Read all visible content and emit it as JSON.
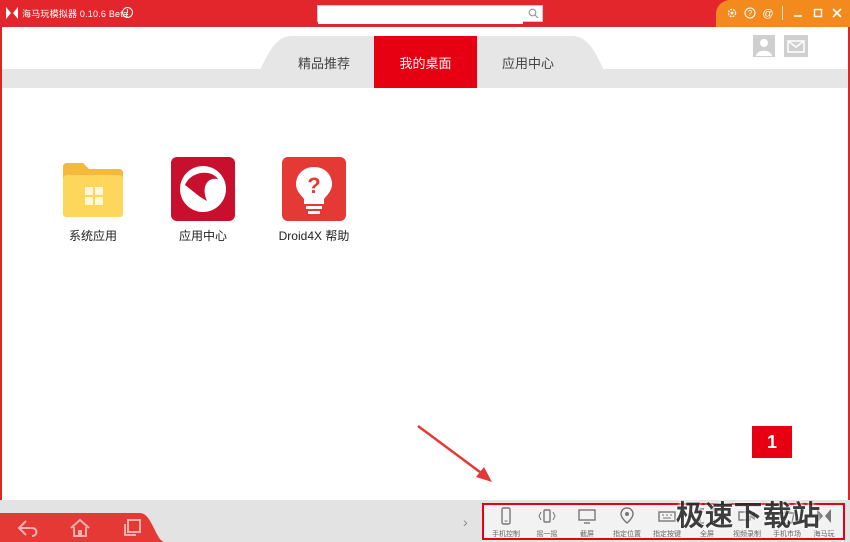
{
  "titlebar": {
    "app_title": "海马玩模拟器 0.10.6 Beta",
    "search_placeholder": "",
    "brand_color": "#e3262c",
    "controls_color": "#f28a1e"
  },
  "topnav": {
    "tabs": [
      {
        "label": "精品推荐",
        "active": false
      },
      {
        "label": "我的桌面",
        "active": true
      },
      {
        "label": "应用中心",
        "active": false
      }
    ]
  },
  "desktop": {
    "apps": [
      {
        "label": "系统应用",
        "icon": "folder-icon"
      },
      {
        "label": "应用中心",
        "icon": "app-center-icon"
      },
      {
        "label": "Droid4X 帮助",
        "icon": "help-bulb-icon"
      }
    ],
    "badge": "1"
  },
  "toolbar": {
    "items": [
      {
        "label": "手机控制",
        "icon": "phone-icon"
      },
      {
        "label": "摇一摇",
        "icon": "shake-icon"
      },
      {
        "label": "截屏",
        "icon": "screenshot-icon"
      },
      {
        "label": "指定位置",
        "icon": "location-icon"
      },
      {
        "label": "指定按键",
        "icon": "keyboard-icon"
      },
      {
        "label": "全屏",
        "icon": "fullscreen-icon"
      },
      {
        "label": "视频录制",
        "icon": "video-record-icon"
      },
      {
        "label": "手机市场",
        "icon": "market-icon"
      },
      {
        "label": "海马玩",
        "icon": "haima-icon"
      }
    ]
  },
  "watermark": "极速下载站"
}
